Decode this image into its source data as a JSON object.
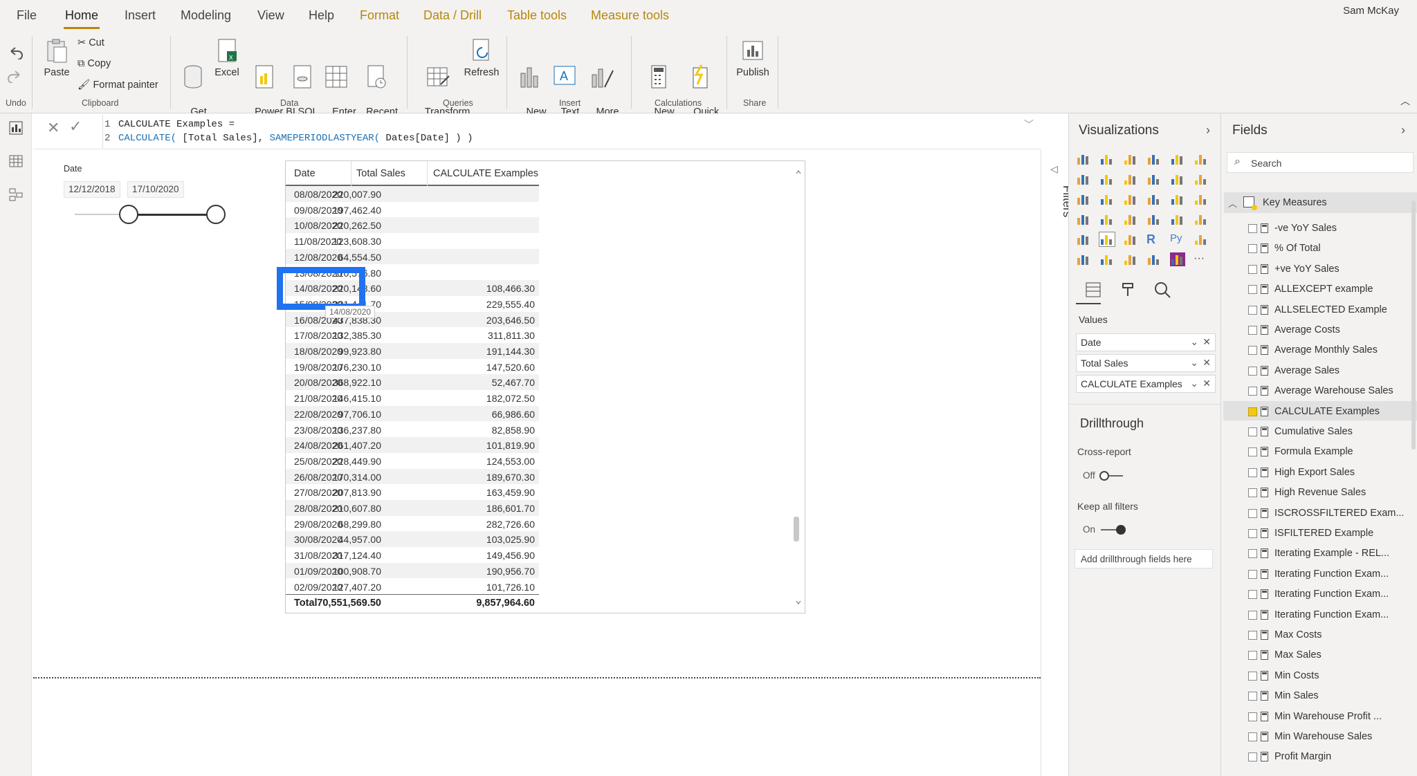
{
  "menu": {
    "tabs": [
      "File",
      "Home",
      "Insert",
      "Modeling",
      "View",
      "Help",
      "Format",
      "Data / Drill",
      "Table tools",
      "Measure tools"
    ],
    "user": "Sam McKay"
  },
  "ribbon": {
    "undo_label": "Undo",
    "clipboard": {
      "paste": "Paste",
      "cut": "Cut",
      "copy": "Copy",
      "format_painter": "Format painter",
      "group": "Clipboard"
    },
    "data": {
      "get_data": "Get\ndata",
      "excel": "Excel",
      "pbi_datasets": "Power BI\ndatasets",
      "sql_server": "SQL\nServer",
      "enter_data": "Enter\ndata",
      "recent_sources": "Recent\nsources",
      "group": "Data"
    },
    "queries": {
      "transform": "Transform\ndata",
      "refresh": "Refresh",
      "group": "Queries"
    },
    "insert": {
      "new_visual": "New\nvisual",
      "text_box": "Text\nbox",
      "more_visuals": "More\nvisuals",
      "group": "Insert"
    },
    "calculations": {
      "new_measure": "New\nmeasure",
      "quick_measure": "Quick\nmeasure",
      "group": "Calculations"
    },
    "share": {
      "publish": "Publish",
      "group": "Share"
    }
  },
  "formula": {
    "line1_num": "1",
    "line1": "CALCULATE Examples =",
    "line2_num": "2",
    "line2_func": "CALCULATE(",
    "line2_mid": " [Total Sales], ",
    "line2_func2": "SAMEPERIODLASTYEAR(",
    "line2_end": " Dates[Date] ) )"
  },
  "slicer": {
    "title": "Date",
    "start": "12/12/2018",
    "end": "17/10/2020",
    "range": [
      0.37,
      0.97
    ]
  },
  "table": {
    "columns": [
      "Date",
      "Total Sales",
      "CALCULATE Examples"
    ],
    "rows": [
      [
        "08/08/2020",
        "220,007.90",
        ""
      ],
      [
        "09/08/2020",
        "197,462.40",
        ""
      ],
      [
        "10/08/2020",
        "220,262.50",
        ""
      ],
      [
        "11/08/2020",
        "123,608.30",
        ""
      ],
      [
        "12/08/2020",
        "64,554.50",
        ""
      ],
      [
        "13/08/2020",
        "110,576.80",
        ""
      ],
      [
        "14/08/2020",
        "220,148.60",
        "108,466.30"
      ],
      [
        "15/08/2020",
        "221,441.70",
        "229,555.40"
      ],
      [
        "16/08/2020",
        "437,838.30",
        "203,646.50"
      ],
      [
        "17/08/2020",
        "132,385.30",
        "311,811.30"
      ],
      [
        "18/08/2020",
        "99,923.80",
        "191,144.30"
      ],
      [
        "19/08/2020",
        "176,230.10",
        "147,520.60"
      ],
      [
        "20/08/2020",
        "368,922.10",
        "52,467.70"
      ],
      [
        "21/08/2020",
        "146,415.10",
        "182,072.50"
      ],
      [
        "22/08/2020",
        "97,706.10",
        "66,986.60"
      ],
      [
        "23/08/2020",
        "136,237.80",
        "82,858.90"
      ],
      [
        "24/08/2020",
        "261,407.20",
        "101,819.90"
      ],
      [
        "25/08/2020",
        "228,449.90",
        "124,553.00"
      ],
      [
        "26/08/2020",
        "170,314.00",
        "189,670.30"
      ],
      [
        "27/08/2020",
        "207,813.90",
        "163,459.90"
      ],
      [
        "28/08/2020",
        "210,607.80",
        "186,601.70"
      ],
      [
        "29/08/2020",
        "68,299.80",
        "282,726.60"
      ],
      [
        "30/08/2020",
        "44,957.00",
        "103,025.90"
      ],
      [
        "31/08/2020",
        "317,124.40",
        "149,456.90"
      ],
      [
        "01/09/2020",
        "100,908.70",
        "190,956.70"
      ],
      [
        "02/09/2020",
        "127,407.20",
        "101,726.10"
      ]
    ],
    "total": [
      "Total",
      "70,551,569.50",
      "9,857,964.60"
    ],
    "tooltip": "14/08/2020"
  },
  "filters_label": "Filters",
  "visualizations": {
    "title": "Visualizations",
    "values_label": "Values",
    "wells": [
      "Date",
      "Total Sales",
      "CALCULATE Examples"
    ],
    "drillthrough": "Drillthrough",
    "cross_report": "Cross-report",
    "cross_report_state": "Off",
    "keep_all_filters": "Keep all filters",
    "keep_all_filters_state": "On",
    "add_drillthrough": "Add drillthrough fields here"
  },
  "fields": {
    "title": "Fields",
    "search_placeholder": "Search",
    "table_name": "Key Measures",
    "items": [
      "-ve YoY Sales",
      "% Of Total",
      "+ve YoY Sales",
      "ALLEXCEPT example",
      "ALLSELECTED Example",
      "Average Costs",
      "Average Monthly Sales",
      "Average Sales",
      "Average Warehouse Sales",
      "CALCULATE Examples",
      "Cumulative Sales",
      "Formula Example",
      "High Export Sales",
      "High Revenue Sales",
      "ISCROSSFILTERED Exam...",
      "ISFILTERED Example",
      "Iterating Example - REL...",
      "Iterating Function Exam...",
      "Iterating Function Exam...",
      "Iterating Function Exam...",
      "Max Costs",
      "Max Sales",
      "Min Costs",
      "Min Sales",
      "Min Warehouse Profit ...",
      "Min Warehouse Sales",
      "Profit Margin"
    ],
    "checked_index": 9
  },
  "colors": {
    "accent": "#b8860b",
    "highlight": "#1f72f0",
    "check": "#f2c811"
  }
}
